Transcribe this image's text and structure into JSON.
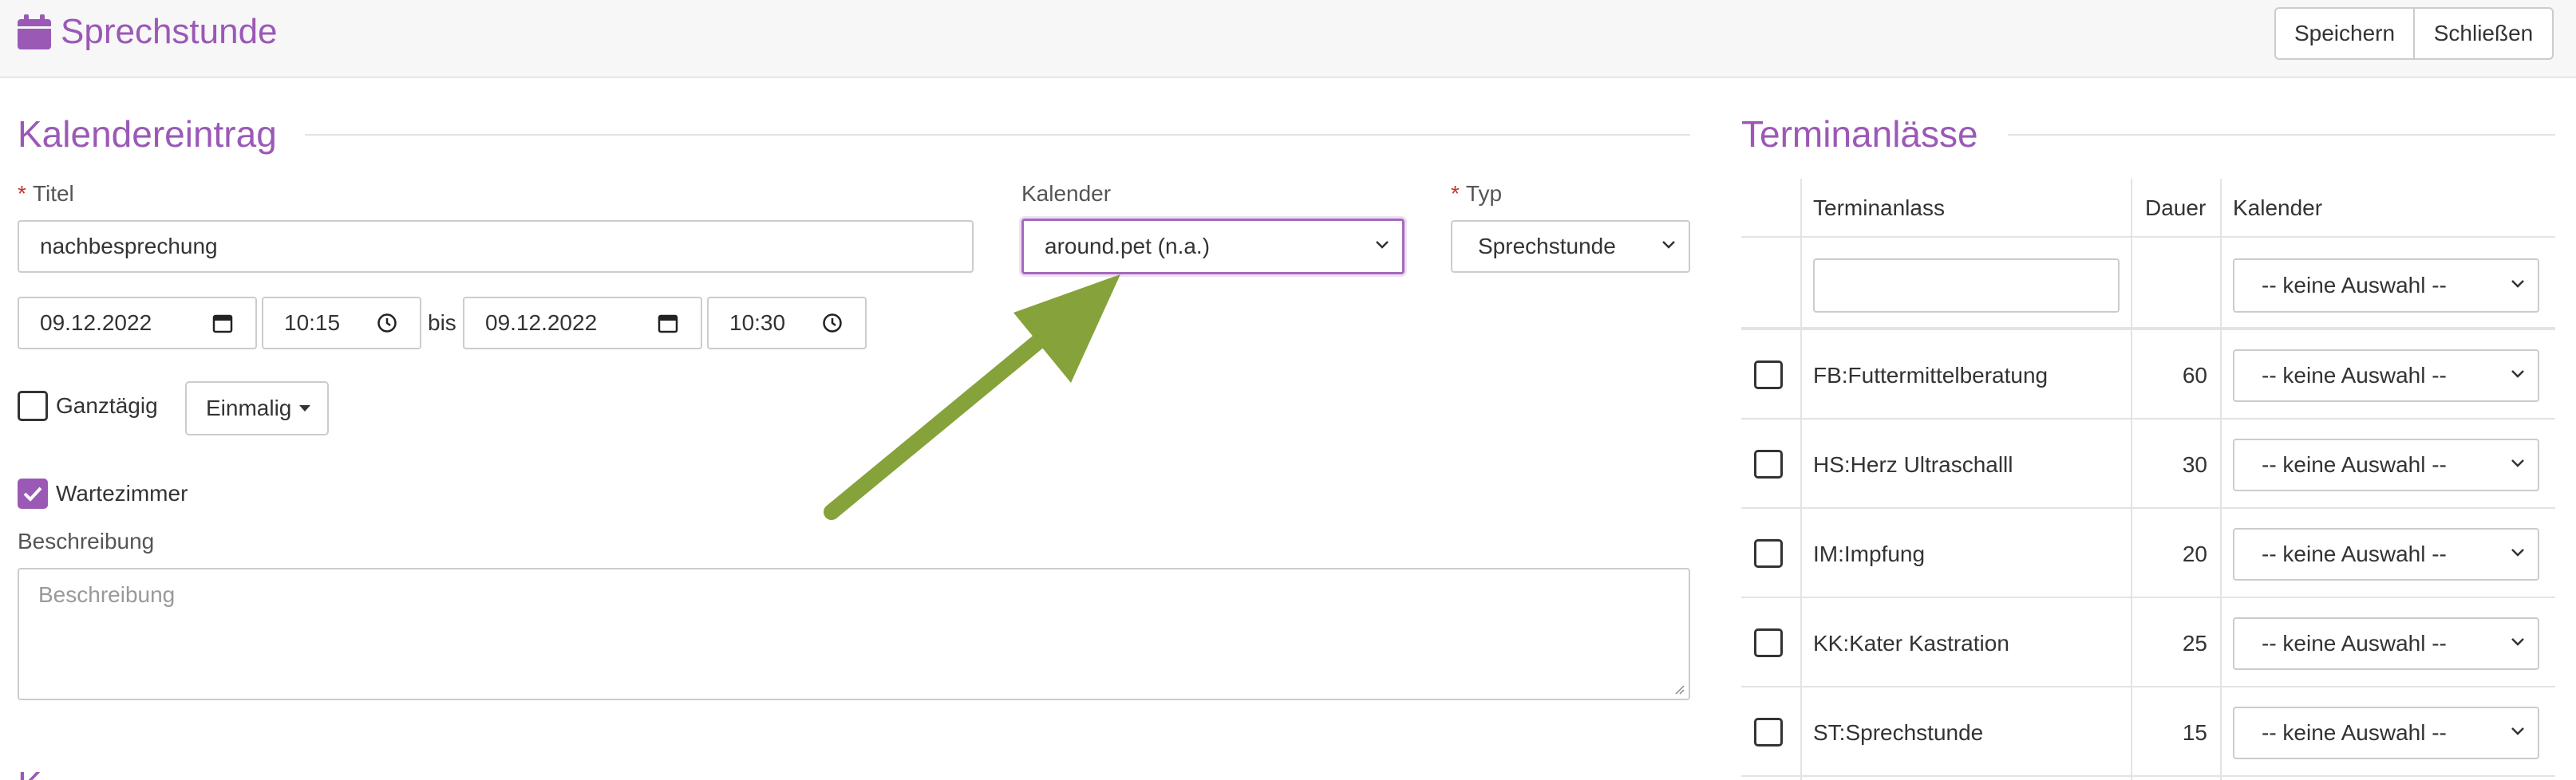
{
  "header": {
    "title": "Sprechstunde",
    "icon": "calendar-icon",
    "save_label": "Speichern",
    "close_label": "Schließen"
  },
  "form": {
    "section_title": "Kalendereintrag",
    "title_label": "Titel",
    "title_value": "nachbesprechung",
    "kalender_label": "Kalender",
    "kalender_value": "around.pet (n.a.)",
    "typ_label": "Typ",
    "typ_value": "Sprechstunde",
    "start_date": "09.12.2022",
    "start_time": "10:15",
    "bis_label": "bis",
    "end_date": "09.12.2022",
    "end_time": "10:30",
    "allday_label": "Ganztägig",
    "allday_checked": false,
    "recurrence_label": "Einmalig",
    "waiting_room_label": "Wartezimmer",
    "waiting_room_checked": true,
    "description_label": "Beschreibung",
    "description_placeholder": "Beschreibung",
    "next_section_partial": "K"
  },
  "terminanlaesse": {
    "section_title": "Terminanlässe",
    "columns": [
      "Terminanlass",
      "Dauer",
      "Kalender"
    ],
    "filter_select": "-- keine Auswahl --",
    "rows": [
      {
        "name": "FB:Futtermittelberatung",
        "duration": "60",
        "calendar": "-- keine Auswahl --",
        "checked": false
      },
      {
        "name": "HS:Herz Ultraschalll",
        "duration": "30",
        "calendar": "-- keine Auswahl --",
        "checked": false
      },
      {
        "name": "IM:Impfung",
        "duration": "20",
        "calendar": "-- keine Auswahl --",
        "checked": false
      },
      {
        "name": "KK:Kater Kastration",
        "duration": "25",
        "calendar": "-- keine Auswahl --",
        "checked": false
      },
      {
        "name": "ST:Sprechstunde",
        "duration": "15",
        "calendar": "-- keine Auswahl --",
        "checked": false
      }
    ]
  },
  "colors": {
    "accent": "#9b59b6",
    "required": "#c0392b",
    "annotation_arrow": "#86a23a"
  }
}
